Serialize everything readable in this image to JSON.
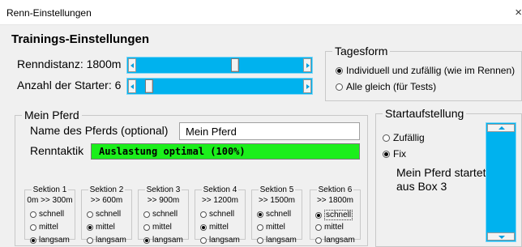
{
  "window": {
    "title": "Renn-Einstellungen",
    "close_glyph": "×"
  },
  "header": {
    "title": "Trainings-Einstellungen"
  },
  "race": {
    "distance_label": "Renndistanz: 1800m",
    "starters_label": "Anzahl der Starter: 6"
  },
  "tagesform": {
    "legend": "Tagesform",
    "options": [
      {
        "label": "Individuell und zufällig (wie im Rennen)",
        "selected": true
      },
      {
        "label": "Alle gleich (für Tests)",
        "selected": false
      }
    ]
  },
  "horse": {
    "legend": "Mein Pferd",
    "name_label": "Name des Pferds (optional)",
    "name_value": "Mein Pferd",
    "tactic_label": "Renntaktik",
    "tactic_value": "Auslastung optimal (100%)",
    "tactic_color": "#1bef1b"
  },
  "sections": [
    {
      "title": "Sektion 1",
      "range": "0m >> 300m",
      "options": [
        "schnell",
        "mittel",
        "langsam"
      ],
      "selected": "langsam"
    },
    {
      "title": "Sektion 2",
      "range": ">> 600m",
      "options": [
        "schnell",
        "mittel",
        "langsam"
      ],
      "selected": "mittel"
    },
    {
      "title": "Sektion 3",
      "range": ">> 900m",
      "options": [
        "schnell",
        "mittel",
        "langsam"
      ],
      "selected": "langsam"
    },
    {
      "title": "Sektion 4",
      "range": ">> 1200m",
      "options": [
        "schnell",
        "mittel",
        "langsam"
      ],
      "selected": "mittel"
    },
    {
      "title": "Sektion 5",
      "range": ">> 1500m",
      "options": [
        "schnell",
        "mittel",
        "langsam"
      ],
      "selected": "schnell"
    },
    {
      "title": "Sektion 6",
      "range": ">> 1800m",
      "options": [
        "schnell",
        "mittel",
        "langsam"
      ],
      "selected": "schnell"
    }
  ],
  "startaufstellung": {
    "legend": "Startaufstellung",
    "options": [
      {
        "label": "Zufällig",
        "selected": false
      },
      {
        "label": "Fix",
        "selected": true
      }
    ],
    "box_text": "Mein Pferd startet aus Box 3"
  },
  "colors": {
    "scrollbar": "#00b2ee",
    "background": "#f0f0f0"
  },
  "icons": {
    "close": "close-icon",
    "scroll_left": "arrow-left-icon",
    "scroll_right": "arrow-right-icon",
    "scroll_up": "arrow-up-icon",
    "scroll_down": "arrow-down-icon"
  }
}
